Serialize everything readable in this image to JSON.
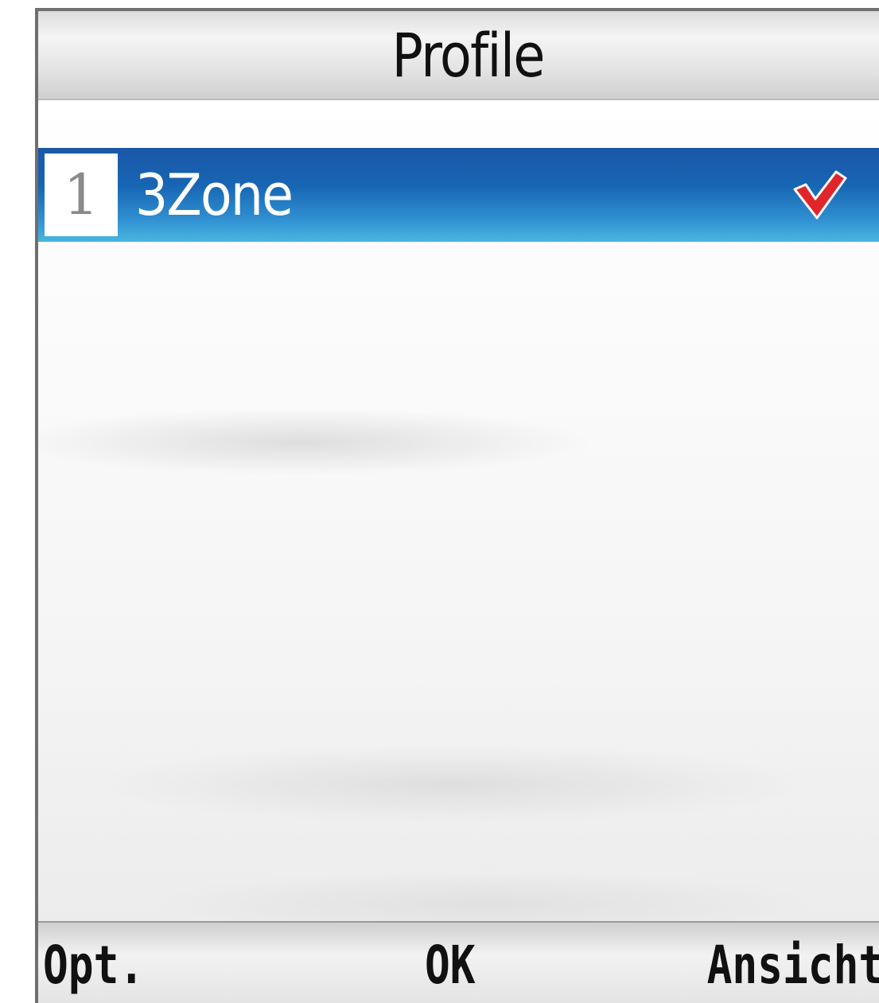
{
  "header": {
    "title": "Profile"
  },
  "profiles": [
    {
      "number": "1",
      "name": "3Zone",
      "selected": true,
      "status_icon": "checkmark-icon"
    }
  ],
  "softkeys": {
    "left": "Opt.",
    "center": "OK",
    "right": "Ansicht"
  },
  "colors": {
    "highlight": "#1766b3",
    "checkmark": "#e0262b"
  }
}
